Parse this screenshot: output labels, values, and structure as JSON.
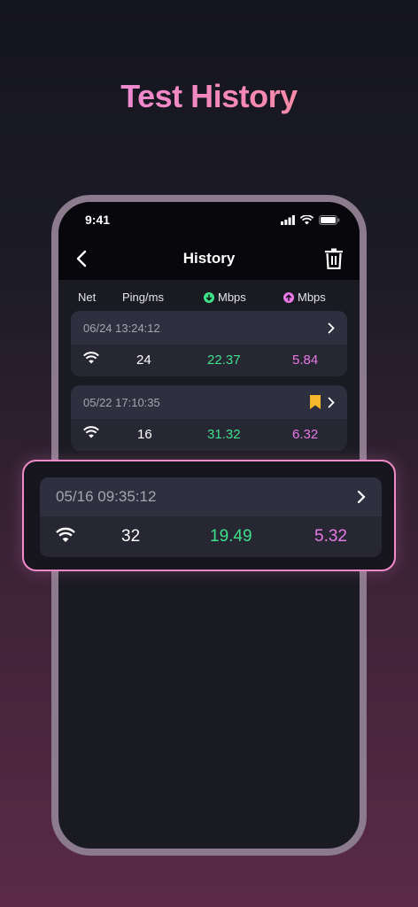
{
  "headline": "Test History",
  "status": {
    "time": "9:41"
  },
  "nav": {
    "title": "History"
  },
  "columns": {
    "net": "Net",
    "ping": "Ping/ms",
    "download": "Mbps",
    "upload": "Mbps"
  },
  "colors": {
    "download": "#3ee08a",
    "upload": "#e879e6",
    "bookmark": "#f5b82a",
    "accent": "#f08ac9"
  },
  "records": [
    {
      "datetime": "06/24 13:24:12",
      "ping": "24",
      "download": "22.37",
      "upload": "5.84",
      "bookmarked": false
    },
    {
      "datetime": "05/22 17:10:35",
      "ping": "16",
      "download": "31.32",
      "upload": "6.32",
      "bookmarked": true
    }
  ],
  "highlighted": {
    "datetime": "05/16 09:35:12",
    "ping": "32",
    "download": "19.49",
    "upload": "5.32"
  }
}
